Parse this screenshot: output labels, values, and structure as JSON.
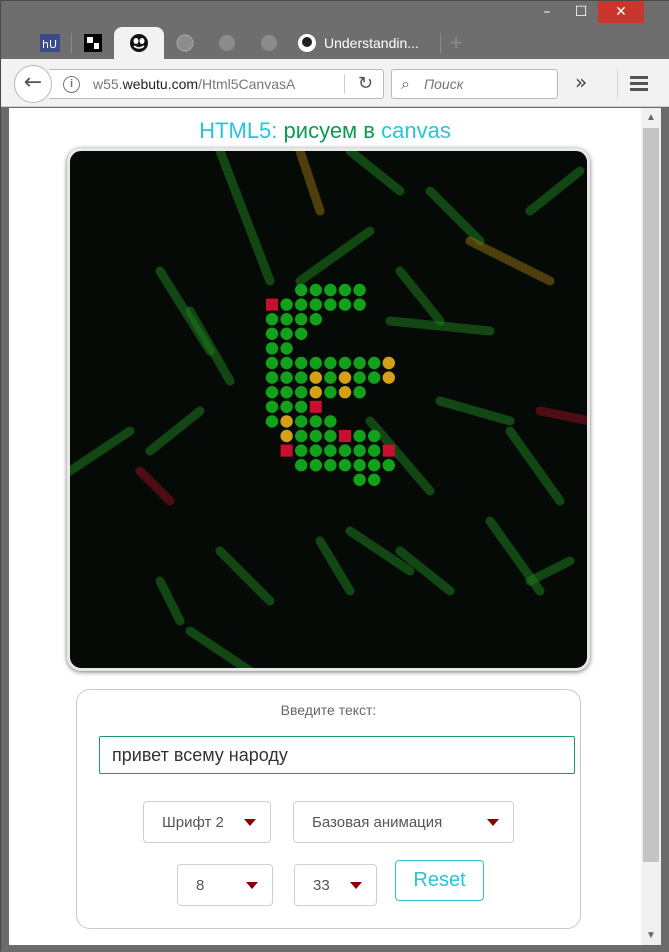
{
  "window": {
    "minimize": "–",
    "maximize": "☐",
    "close": "✕"
  },
  "tabs": [
    {
      "name": "tab-hu",
      "icon": "hu-logo-icon"
    },
    {
      "name": "tab-puzzle",
      "icon": "puzzle-icon"
    },
    {
      "name": "tab-active",
      "icon": "face-icon"
    },
    {
      "name": "tab-blank-1",
      "icon": "globe-icon"
    },
    {
      "name": "tab-blank-2",
      "icon": "globe-icon"
    },
    {
      "name": "tab-blank-3",
      "icon": "globe-icon"
    },
    {
      "name": "tab-github",
      "icon": "github-icon",
      "label": "Understandin..."
    }
  ],
  "new_tab": "+",
  "navbar": {
    "url_prefix": "w55.",
    "url_domain": "webutu.com",
    "url_path": "/Html5CanvasA",
    "search_placeholder": "Поиск",
    "overflow": "»"
  },
  "page": {
    "title_part1": "HTML5",
    "title_colon": ":",
    "title_part2": "рисуем в",
    "title_part3": "canvas",
    "panel_label": "Введите текст:",
    "text_value": "привет всему народу",
    "font_select": "Шрифт 2",
    "animation_select": "Базовая анимация",
    "size_select": "8",
    "count_select": "33",
    "reset_label": "Reset"
  },
  "colors": {
    "accent_cyan": "#26c6d6",
    "accent_green": "#0b9a52",
    "dot_green": "#12a11a",
    "dot_yellow": "#d4a017",
    "dot_red": "#c8102e",
    "caret": "#8b0000"
  },
  "canvas": {
    "letter": "Б",
    "dots": [
      [
        0,
        2,
        "g"
      ],
      [
        0,
        3,
        "g"
      ],
      [
        0,
        4,
        "g"
      ],
      [
        0,
        5,
        "g"
      ],
      [
        0,
        6,
        "g"
      ],
      [
        1,
        0,
        "r"
      ],
      [
        1,
        1,
        "g"
      ],
      [
        1,
        2,
        "g"
      ],
      [
        1,
        3,
        "g"
      ],
      [
        1,
        4,
        "g"
      ],
      [
        1,
        5,
        "g"
      ],
      [
        1,
        6,
        "g"
      ],
      [
        2,
        0,
        "g"
      ],
      [
        2,
        1,
        "g"
      ],
      [
        2,
        2,
        "g"
      ],
      [
        2,
        3,
        "g"
      ],
      [
        3,
        0,
        "g"
      ],
      [
        3,
        1,
        "g"
      ],
      [
        3,
        2,
        "g"
      ],
      [
        4,
        0,
        "g"
      ],
      [
        4,
        1,
        "g"
      ],
      [
        5,
        0,
        "g"
      ],
      [
        5,
        1,
        "g"
      ],
      [
        5,
        2,
        "g"
      ],
      [
        5,
        3,
        "g"
      ],
      [
        5,
        4,
        "g"
      ],
      [
        5,
        5,
        "g"
      ],
      [
        5,
        6,
        "g"
      ],
      [
        5,
        7,
        "g"
      ],
      [
        5,
        8,
        "y"
      ],
      [
        6,
        0,
        "g"
      ],
      [
        6,
        1,
        "g"
      ],
      [
        6,
        2,
        "g"
      ],
      [
        6,
        3,
        "y"
      ],
      [
        6,
        4,
        "g"
      ],
      [
        6,
        5,
        "y"
      ],
      [
        6,
        6,
        "g"
      ],
      [
        6,
        7,
        "g"
      ],
      [
        6,
        8,
        "y"
      ],
      [
        7,
        0,
        "g"
      ],
      [
        7,
        1,
        "g"
      ],
      [
        7,
        2,
        "g"
      ],
      [
        7,
        3,
        "y"
      ],
      [
        7,
        4,
        "g"
      ],
      [
        7,
        5,
        "y"
      ],
      [
        7,
        6,
        "g"
      ],
      [
        8,
        0,
        "g"
      ],
      [
        8,
        1,
        "g"
      ],
      [
        8,
        2,
        "g"
      ],
      [
        8,
        3,
        "r"
      ],
      [
        9,
        0,
        "g"
      ],
      [
        9,
        1,
        "y"
      ],
      [
        9,
        2,
        "g"
      ],
      [
        9,
        3,
        "g"
      ],
      [
        9,
        4,
        "g"
      ],
      [
        10,
        1,
        "y"
      ],
      [
        10,
        2,
        "g"
      ],
      [
        10,
        3,
        "g"
      ],
      [
        10,
        4,
        "g"
      ],
      [
        10,
        5,
        "r"
      ],
      [
        10,
        6,
        "g"
      ],
      [
        10,
        7,
        "g"
      ],
      [
        11,
        1,
        "r"
      ],
      [
        11,
        2,
        "g"
      ],
      [
        11,
        3,
        "g"
      ],
      [
        11,
        4,
        "g"
      ],
      [
        11,
        5,
        "g"
      ],
      [
        11,
        6,
        "g"
      ],
      [
        11,
        7,
        "g"
      ],
      [
        11,
        8,
        "r"
      ],
      [
        12,
        2,
        "g"
      ],
      [
        12,
        3,
        "g"
      ],
      [
        12,
        4,
        "g"
      ],
      [
        12,
        5,
        "g"
      ],
      [
        12,
        6,
        "g"
      ],
      [
        12,
        7,
        "g"
      ],
      [
        12,
        8,
        "g"
      ],
      [
        13,
        6,
        "g"
      ],
      [
        13,
        7,
        "g"
      ]
    ],
    "streaks": [
      [
        150,
        0,
        200,
        130,
        "g"
      ],
      [
        230,
        130,
        300,
        80,
        "g"
      ],
      [
        280,
        0,
        330,
        40,
        "g"
      ],
      [
        330,
        120,
        370,
        170,
        "g"
      ],
      [
        360,
        40,
        410,
        90,
        "g"
      ],
      [
        400,
        90,
        480,
        130,
        "y"
      ],
      [
        460,
        60,
        510,
        20,
        "g"
      ],
      [
        320,
        170,
        420,
        180,
        "g"
      ],
      [
        90,
        120,
        140,
        200,
        "g"
      ],
      [
        120,
        160,
        160,
        230,
        "g"
      ],
      [
        80,
        300,
        130,
        260,
        "g"
      ],
      [
        0,
        320,
        60,
        280,
        "g"
      ],
      [
        370,
        250,
        440,
        270,
        "g"
      ],
      [
        470,
        260,
        520,
        270,
        "r"
      ],
      [
        440,
        280,
        490,
        350,
        "g"
      ],
      [
        300,
        270,
        360,
        340,
        "g"
      ],
      [
        280,
        380,
        340,
        420,
        "g"
      ],
      [
        420,
        370,
        470,
        440,
        "g"
      ],
      [
        460,
        430,
        500,
        410,
        "g"
      ],
      [
        250,
        390,
        280,
        440,
        "g"
      ],
      [
        150,
        400,
        200,
        450,
        "g"
      ],
      [
        90,
        430,
        110,
        470,
        "g"
      ],
      [
        120,
        480,
        180,
        520,
        "g"
      ],
      [
        330,
        400,
        380,
        440,
        "g"
      ],
      [
        230,
        0,
        250,
        60,
        "y"
      ],
      [
        70,
        320,
        100,
        350,
        "r"
      ]
    ]
  }
}
